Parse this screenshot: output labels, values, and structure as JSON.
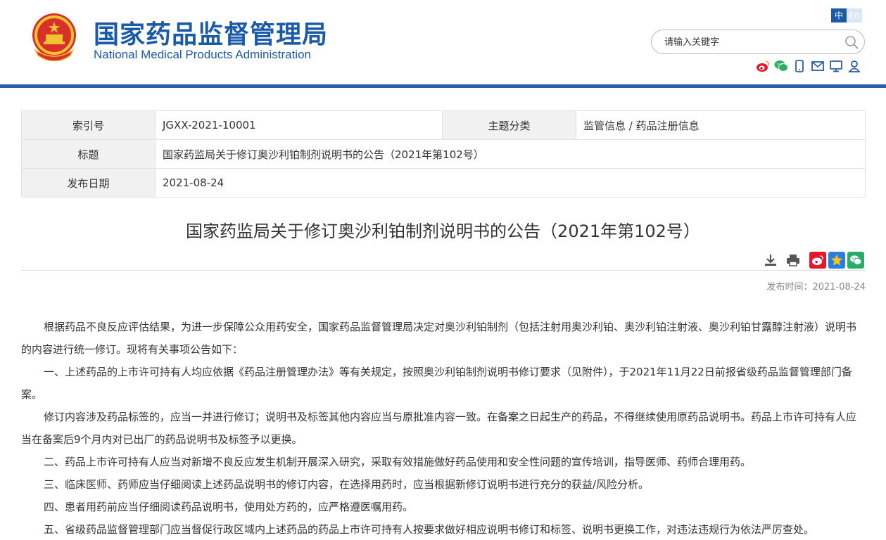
{
  "header": {
    "title_cn": "国家药品监督管理局",
    "title_en": "National Medical Products Administration",
    "lang_zh": "中",
    "lang_en": "En",
    "search_placeholder": "请输入关键字"
  },
  "colors": {
    "brand_blue": "#1a5aa8",
    "header_bar": "#2a5ea8",
    "weibo_red": "#e6162d",
    "wechat_green": "#2aae67"
  },
  "info": {
    "index_label": "索引号",
    "index_value": "JGXX-2021-10001",
    "category_label": "主题分类",
    "category_value": "监管信息 / 药品注册信息",
    "title_label": "标题",
    "title_value": "国家药监局关于修订奥沙利铂制剂说明书的公告（2021年第102号）",
    "date_label": "发布日期",
    "date_value": "2021-08-24"
  },
  "article": {
    "title": "国家药监局关于修订奥沙利铂制剂说明书的公告（2021年第102号）",
    "pubtime": "发布时间：2021-08-24",
    "paragraphs": [
      "根据药品不良反应评估结果，为进一步保障公众用药安全，国家药品监督管理局决定对奥沙利铂制剂（包括注射用奥沙利铂、奥沙利铂注射液、奥沙利铂甘露醇注射液）说明书的内容进行统一修订。现将有关事项公告如下：",
      "一、上述药品的上市许可持有人均应依据《药品注册管理办法》等有关规定，按照奥沙利铂制剂说明书修订要求（见附件），于2021年11月22日前报省级药品监督管理部门备案。",
      "修订内容涉及药品标签的，应当一并进行修订；说明书及标签其他内容应当与原批准内容一致。在备案之日起生产的药品，不得继续使用原药品说明书。药品上市许可持有人应当在备案后9个月内对已出厂的药品说明书及标签予以更换。",
      "二、药品上市许可持有人应当对新增不良反应发生机制开展深入研究，采取有效措施做好药品使用和安全性问题的宣传培训，指导医师、药师合理用药。",
      "三、临床医师、药师应当仔细阅读上述药品说明书的修订内容，在选择用药时，应当根据新修订说明书进行充分的获益/风险分析。",
      "四、患者用药前应当仔细阅读药品说明书，使用处方药的，应严格遵医嘱用药。",
      "五、省级药品监督管理部门应当督促行政区域内上述药品的药品上市许可持有人按要求做好相应说明书修订和标签、说明书更换工作，对违法违规行为依法严厉查处。"
    ]
  }
}
